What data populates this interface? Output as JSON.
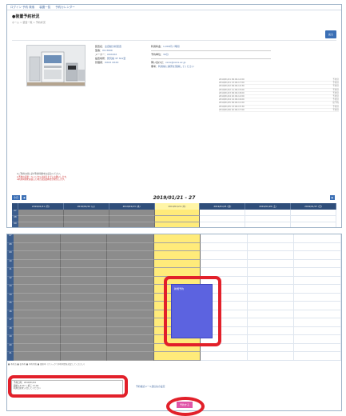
{
  "nav": [
    "ログイン 予約 検索",
    "装置一覧",
    "予約カレンダー"
  ],
  "page": {
    "title": "●装置予約状況",
    "breadcrumb": "ホーム > 装置一覧 > 予約状況",
    "back_button": "戻る"
  },
  "device": {
    "photo_label": "instrument-photo",
    "left_fields": [
      {
        "k": "装置名",
        "v": "全自動分析装置"
      },
      {
        "k": "型番",
        "v": "XX-3000"
      },
      {
        "k": "メーカー",
        "v": "XXXXXX"
      },
      {
        "k": "設置場所",
        "v": "研究棟 3F 301室"
      },
      {
        "k": "管理者",
        "v": "XXXX XXXX"
      }
    ],
    "right_fields": [
      {
        "k": "利用料金",
        "v": "1,000円 / 時間"
      },
      {
        "k": "予約単位",
        "v": "30分"
      },
      {
        "k": "問い合わせ",
        "v": "xxxx@xxxx.ac.jp"
      },
      {
        "k": "備考",
        "v": "利用前に講習を受講してください"
      }
    ]
  },
  "schedule_list": [
    {
      "name": "2019/01/21 09:00-12:00",
      "status": "予約済"
    },
    {
      "name": "2019/01/21 13:00-17:00",
      "status": "予約済"
    },
    {
      "name": "2019/01/22 09:00-10:30",
      "status": "予約済"
    },
    {
      "name": "2019/01/22 11:00-15:00",
      "status": "予約済"
    },
    {
      "name": "2019/01/23 09:00-18:00",
      "status": "予約済"
    },
    {
      "name": "2019/01/24 10:00-12:00",
      "status": "予約済"
    },
    {
      "name": "2019/01/24 14:00-16:00",
      "status": "予約済"
    },
    {
      "name": "2019/01/25 09:00-11:00",
      "status": "仮予約"
    },
    {
      "name": "2019/01/25 13:00-15:30",
      "status": "予約済"
    },
    {
      "name": "2019/01/26 10:00-17:00",
      "status": "予約済"
    }
  ],
  "notes": [
    "※ご利用の前に必ず利用規約をお読みください。",
    "※予約の変更・キャンセルは前日までにお願いします。",
    "※利用時間を超過した場合は追加料金が発生します。"
  ],
  "toolbar": {
    "today_button": "今日",
    "prev_button": "◀",
    "next_button": "▶",
    "date_range": "2019/01/21 - 27"
  },
  "calendar": {
    "days": [
      "2019/01/21 (月)",
      "2019/01/22 (火)",
      "2019/01/23 (水)",
      "2019/01/24 (木)",
      "2019/01/25 (金)",
      "2019/01/26 (土)",
      "2019/01/27 (日)"
    ],
    "selected_index": 3,
    "times": [
      "07",
      "08",
      "09",
      "10",
      "11",
      "12",
      "13",
      "14",
      "15",
      "16",
      "17",
      "18",
      "19",
      "20",
      "21"
    ],
    "new_booking": {
      "label": "新規予約",
      "day_index": 3
    }
  },
  "legend": "■ 予約済 ■ 仮予約 ■ 予約可能 ■ 選択中（クリックで予約時間を指定してください）",
  "form": {
    "line1": "予約日時：2019/01/24",
    "line2": "開始 13:00 ～ 終了 17:00",
    "line3": "利用目的を入力してください"
  },
  "link_text": "予約確認メール送信先の設定",
  "submit_button": "予約する"
}
